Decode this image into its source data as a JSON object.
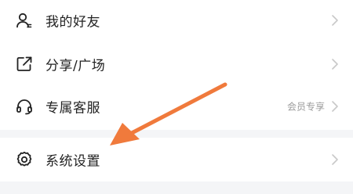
{
  "menu": {
    "items": [
      {
        "label": "我的好友",
        "icon": "person-icon",
        "badge": ""
      },
      {
        "label": "分享/广场",
        "icon": "share-icon",
        "badge": ""
      },
      {
        "label": "专属客服",
        "icon": "headset-icon",
        "badge": "会员专享"
      },
      {
        "label": "系统设置",
        "icon": "gear-icon",
        "badge": ""
      }
    ]
  },
  "colors": {
    "background": "#f4f5f7",
    "card": "#ffffff",
    "text": "#222222",
    "secondary_text": "#9a9a9a",
    "chevron": "#c8c8c8",
    "annotation_arrow": "#f07a3c"
  },
  "annotation": {
    "type": "arrow",
    "points_to": "系统设置"
  }
}
